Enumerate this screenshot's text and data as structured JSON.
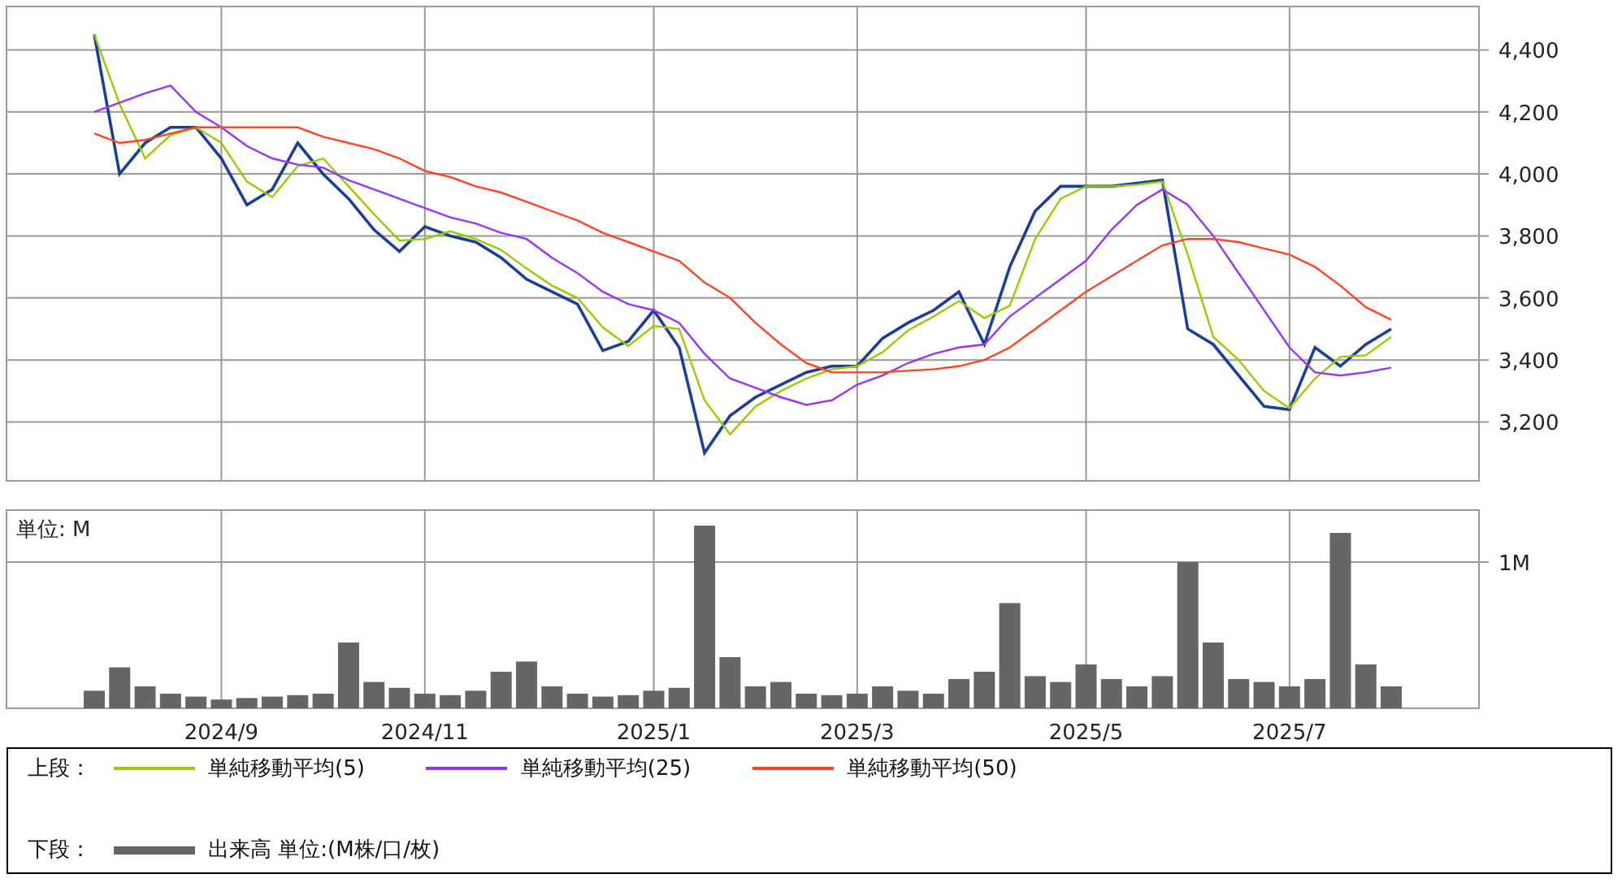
{
  "price_panel": {
    "chart_data": {
      "type": "line",
      "categories": [
        null,
        null,
        null,
        null,
        null,
        null,
        null,
        null,
        null,
        null,
        null,
        null,
        null,
        null,
        null,
        null,
        null,
        null,
        null,
        null,
        null,
        null,
        null,
        null,
        null,
        null,
        null,
        null,
        null,
        null,
        null,
        null,
        null,
        null,
        null,
        null,
        null,
        null,
        null,
        null,
        null,
        null,
        null,
        null,
        null,
        null,
        null,
        null,
        null,
        null,
        null,
        null
      ],
      "grid": true,
      "ylim": [
        3010,
        4540
      ],
      "yticks": [
        {
          "value": 3200,
          "label": "3,200"
        },
        {
          "value": 3400,
          "label": "3,400"
        },
        {
          "value": 3600,
          "label": "3,600"
        },
        {
          "value": 3800,
          "label": "3,800"
        },
        {
          "value": 4000,
          "label": "4,000"
        },
        {
          "value": 4200,
          "label": "4,200"
        },
        {
          "value": 4400,
          "label": "4,400"
        }
      ],
      "series": [
        {
          "color": "#1a3f99",
          "values": [
            4450,
            4000,
            4100,
            4150,
            4150,
            4050,
            3900,
            3950,
            4100,
            4000,
            3920,
            3820,
            3750,
            3830,
            3800,
            3780,
            3730,
            3660,
            3620,
            3580,
            3430,
            3460,
            3560,
            3440,
            3100,
            3220,
            3280,
            3320,
            3360,
            3380,
            3380,
            3470,
            3520,
            3560,
            3620,
            3450,
            3700,
            3880,
            3960,
            3960,
            3960,
            3970,
            3980,
            3500,
            3450,
            3350,
            3250,
            3240,
            3440,
            3380,
            3450,
            3500
          ]
        },
        {
          "name": "単純移動平均(5)",
          "color": "#99cc00",
          "values": [
            4450,
            4225,
            4050,
            4125,
            4150,
            4100,
            3975,
            3925,
            4025,
            4050,
            3960,
            3870,
            3785,
            3790,
            3815,
            3790,
            3755,
            3695,
            3640,
            3600,
            3505,
            3445,
            3510,
            3500,
            3270,
            3160,
            3250,
            3300,
            3340,
            3370,
            3380,
            3425,
            3495,
            3540,
            3590,
            3535,
            3575,
            3790,
            3920,
            3960,
            3960,
            3965,
            3975,
            3740,
            3475,
            3400,
            3300,
            3245,
            3340,
            3410,
            3415,
            3475
          ]
        },
        {
          "name": "単純移動平均(25)",
          "color": "#9933ff",
          "values": [
            4200,
            4230,
            4260,
            4285,
            4200,
            4150,
            4090,
            4050,
            4030,
            4020,
            3980,
            3950,
            3920,
            3890,
            3860,
            3840,
            3810,
            3790,
            3730,
            3680,
            3620,
            3580,
            3560,
            3520,
            3420,
            3340,
            3310,
            3280,
            3255,
            3270,
            3320,
            3350,
            3390,
            3420,
            3440,
            3450,
            3540,
            3600,
            3660,
            3720,
            3820,
            3900,
            3950,
            3900,
            3800,
            3680,
            3560,
            3440,
            3360,
            3350,
            3360,
            3375
          ]
        },
        {
          "name": "単純移動平均(50)",
          "color": "#ff4422",
          "values": [
            4130,
            4100,
            4110,
            4130,
            4150,
            4150,
            4150,
            4150,
            4150,
            4120,
            4100,
            4080,
            4050,
            4010,
            3990,
            3960,
            3940,
            3910,
            3880,
            3850,
            3810,
            3780,
            3750,
            3720,
            3650,
            3600,
            3520,
            3450,
            3390,
            3360,
            3360,
            3360,
            3365,
            3370,
            3380,
            3400,
            3440,
            3500,
            3560,
            3620,
            3670,
            3720,
            3770,
            3790,
            3790,
            3780,
            3760,
            3740,
            3700,
            3640,
            3570,
            3530
          ]
        }
      ]
    }
  },
  "volume_panel": {
    "chart_data": {
      "type": "bar",
      "ylabel": "単位: M",
      "categories": [
        null,
        null,
        null,
        null,
        null,
        "2024/9",
        null,
        null,
        null,
        null,
        null,
        null,
        null,
        "2024/11",
        null,
        null,
        null,
        null,
        null,
        null,
        null,
        null,
        "2025/1",
        null,
        null,
        null,
        null,
        null,
        null,
        null,
        "2025/3",
        null,
        null,
        null,
        null,
        null,
        null,
        null,
        null,
        "2025/5",
        null,
        null,
        null,
        null,
        null,
        null,
        null,
        "2025/7",
        null,
        null,
        null,
        null
      ],
      "grid": true,
      "ylim": [
        0,
        1.356
      ],
      "yticks": [
        {
          "value": 1,
          "label": "1M"
        }
      ],
      "series": [
        {
          "name": "出来高 単位:(M株/口/枚)",
          "color": "#666666",
          "values": [
            0.12,
            0.28,
            0.15,
            0.1,
            0.08,
            0.06,
            0.07,
            0.08,
            0.09,
            0.1,
            0.45,
            0.18,
            0.14,
            0.1,
            0.09,
            0.12,
            0.25,
            0.32,
            0.15,
            0.1,
            0.08,
            0.09,
            0.12,
            0.14,
            1.25,
            0.35,
            0.15,
            0.18,
            0.1,
            0.09,
            0.1,
            0.15,
            0.12,
            0.1,
            0.2,
            0.25,
            0.72,
            0.22,
            0.18,
            0.3,
            0.2,
            0.15,
            0.22,
            1.0,
            0.45,
            0.2,
            0.18,
            0.15,
            0.2,
            1.2,
            0.3,
            0.15
          ]
        }
      ]
    }
  },
  "legend": {
    "upper_label": "上段：",
    "lower_label": "下段："
  }
}
